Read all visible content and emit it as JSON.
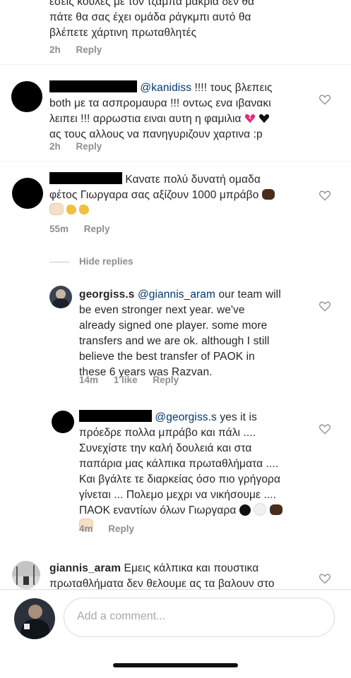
{
  "comments": [
    {
      "text_lines": [
        "εσείς κούλες με τον τζάμπα μακριά δεν θα",
        "πάτε θα σας έχει ομάδα ράγκμπι αυτό θα",
        "βλέπετε χάρτινη πρωταθλητές"
      ],
      "time": "2h",
      "reply": "Reply"
    },
    {
      "mention": "@kanidiss",
      "line1_rest": " !!!! τους βλεπεις",
      "text_lines": [
        "both με τα ασπρομαυρα !!! οντως ενα ιβανακι",
        "λειπει !!! αρρωστια ειναι αυτη η φαμιλια",
        "ας τους αλλους να πανηγυριζουν χαρτινα :p"
      ],
      "time": "2h",
      "reply": "Reply"
    },
    {
      "line1_rest": "Κανατε πολύ δυνατή ομαδα",
      "text_lines": [
        "φέτος Γιωργαρα σας αξίζουν 1000 μπράβο"
      ],
      "time": "55m",
      "reply": "Reply"
    }
  ],
  "hide_replies": "Hide replies",
  "replies": [
    {
      "username": "georgiss.s",
      "mention": "@giannis_aram",
      "line1_rest": " our team will",
      "text_lines": [
        "be even stronger next year. we've",
        "already signed one player. some more",
        "transfers and we are ok. although I still",
        "believe the best transfer of PAOK in",
        "these 6 years was Razvan."
      ],
      "time": "14m",
      "likes": "1 like",
      "reply": "Reply"
    },
    {
      "mention": "@georgiss.s",
      "line1_rest": " yes it is",
      "text_lines": [
        "πρόεδρε πολλα μπράβο και πάλι ....",
        "Συνεχίστε την καλή δουλειά και στα",
        "παπάρια μας κάλπικα πρωταθλήματα ....",
        "Και βγάλτε τε διαρκείας όσο πιο γρήγορα",
        "γίνεται ... Πολεμο μεχρι να νικήσουμε ....",
        "ΠΑΟΚ εναντίων όλων Γιωργαρα"
      ],
      "time": "4m",
      "reply": "Reply"
    }
  ],
  "last_comment": {
    "username": "giannis_aram",
    "line1_rest": " Εμεις κάλπικα και πουστικα",
    "text_lines": [
      "πρωταθλήματα δεν θελουμε ας τα βαλουν στο"
    ]
  },
  "composer": {
    "placeholder": "Add a comment..."
  },
  "icons": [
    "heart-outline-icon",
    "broken-heart-emoji",
    "black-heart-emoji",
    "fist-emoji",
    "clap-emoji",
    "black-circle-emoji",
    "white-circle-emoji"
  ],
  "colors": {
    "text": "#262626",
    "meta": "#8e8e8e",
    "mention": "#00376b",
    "border": "#dbdbdb"
  }
}
